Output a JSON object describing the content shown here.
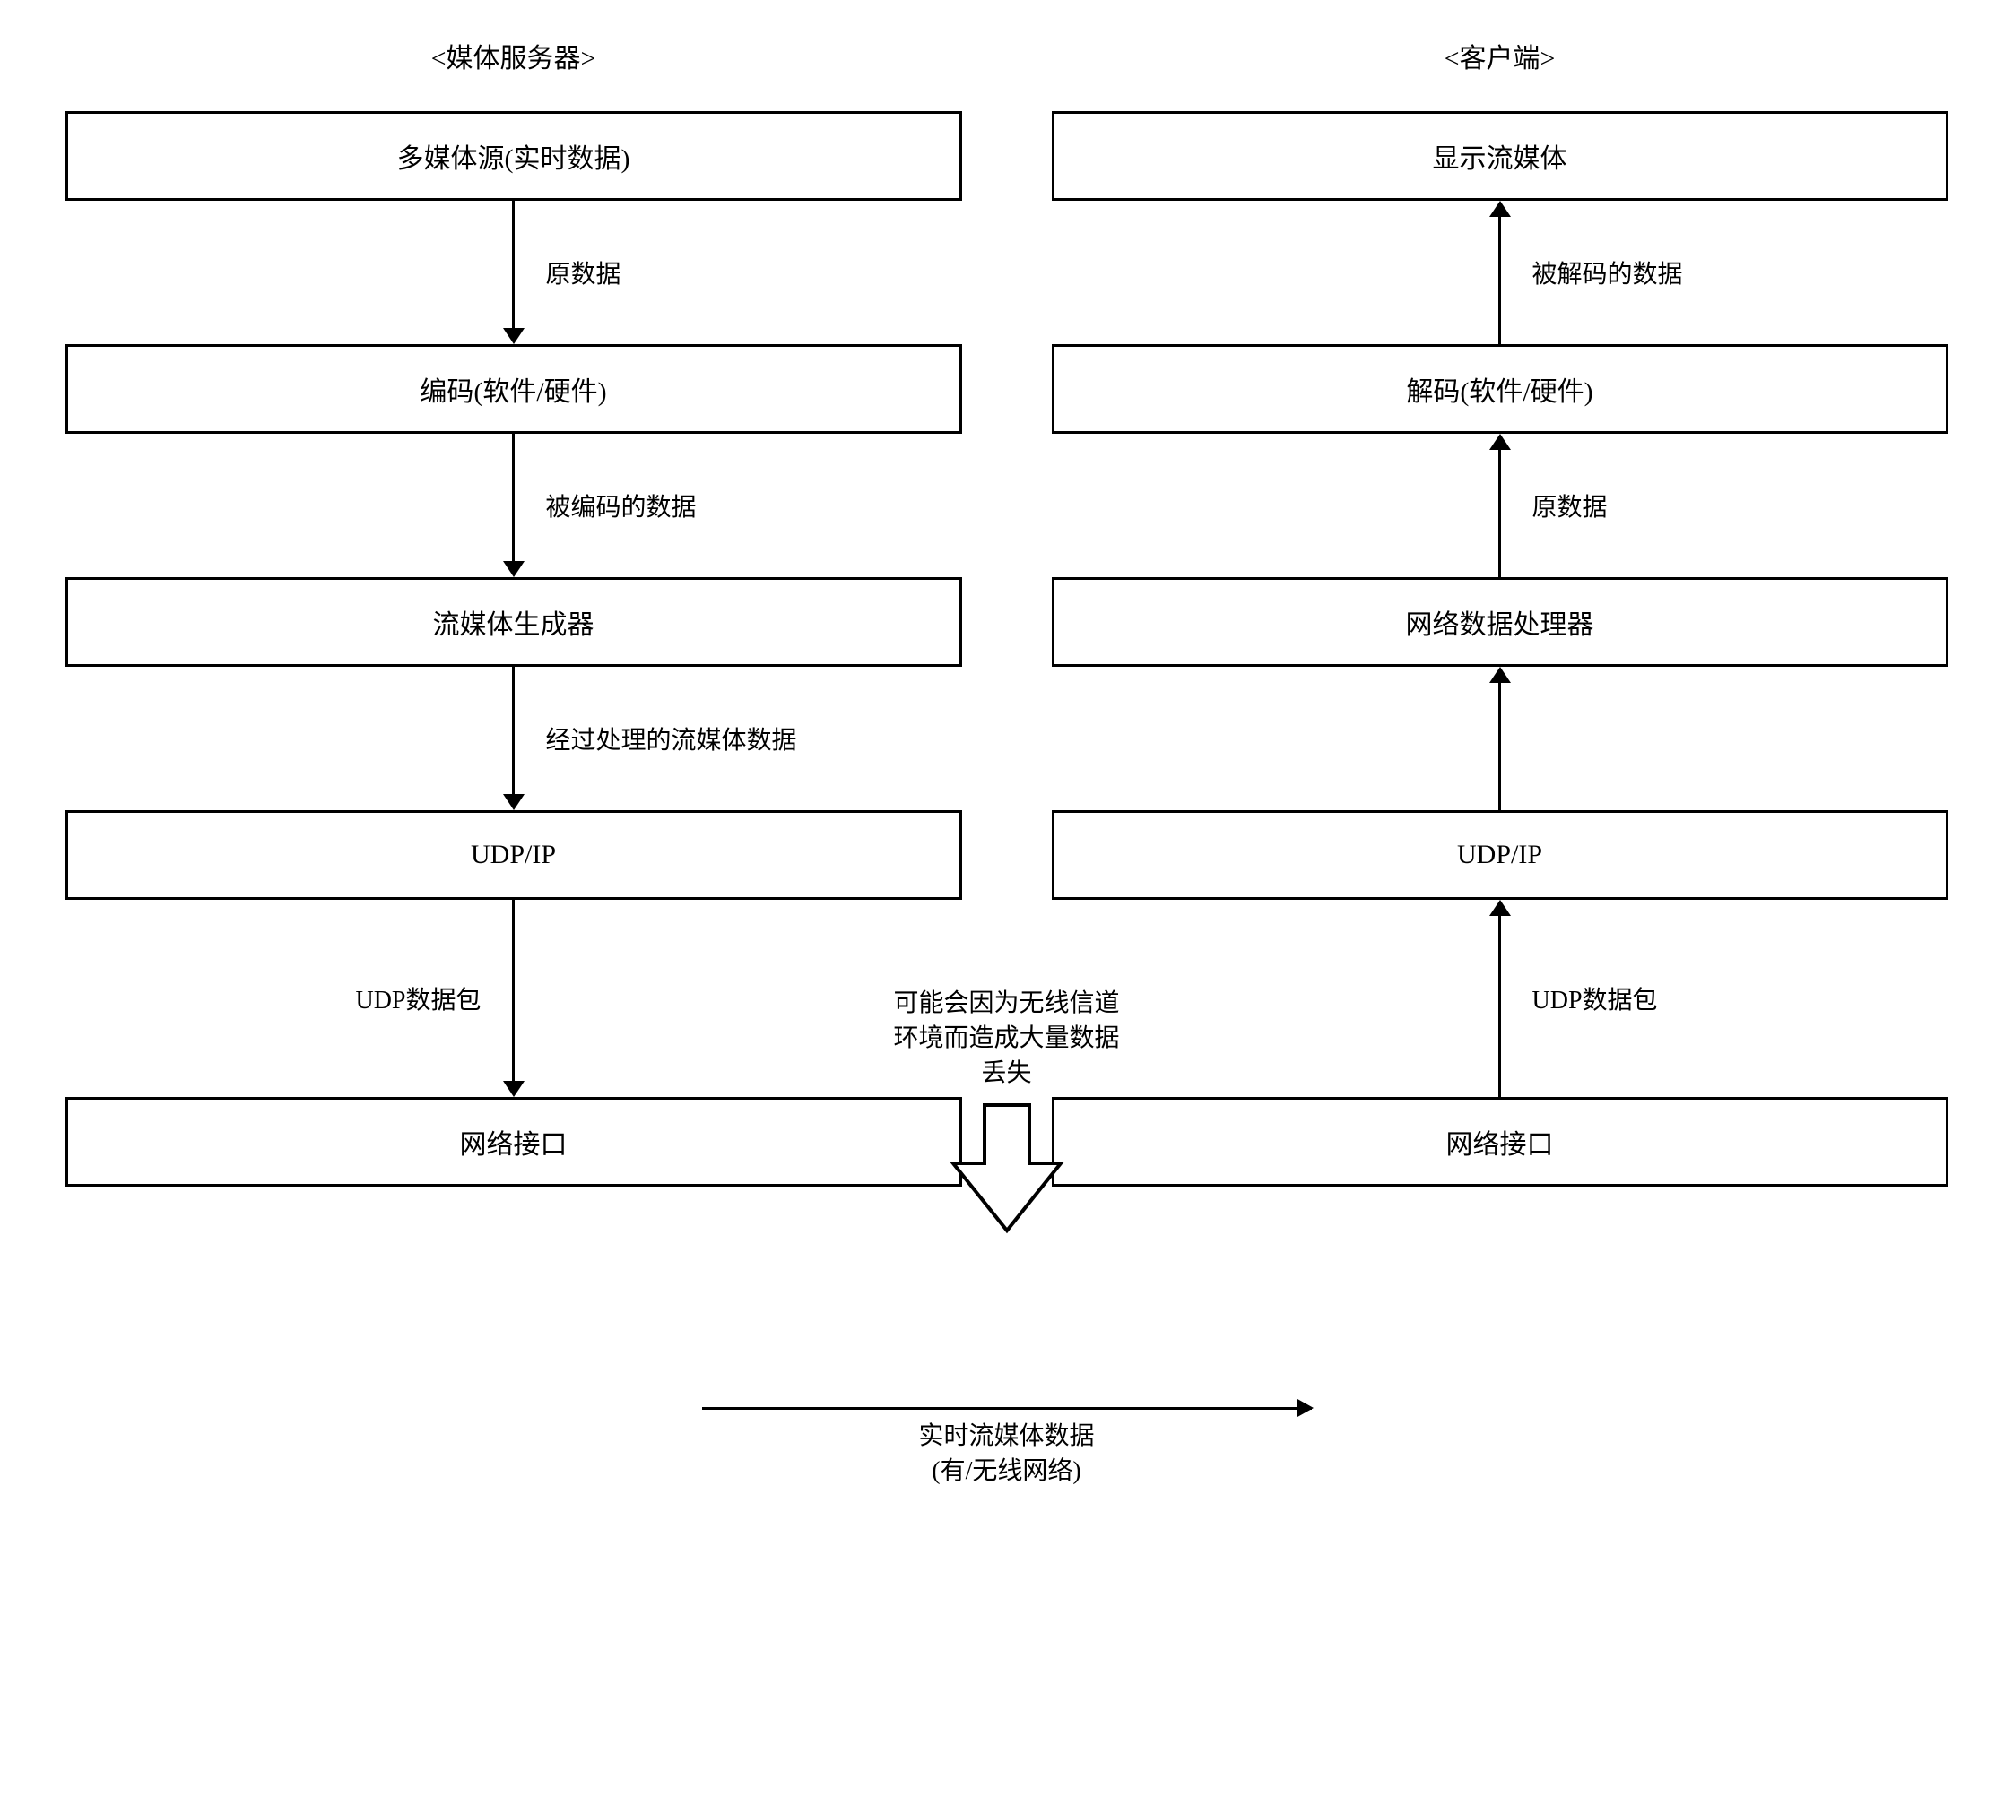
{
  "server": {
    "title": "<媒体服务器>",
    "boxes": {
      "source": "多媒体源(实时数据)",
      "encode": "编码(软件/硬件)",
      "streamer": "流媒体生成器",
      "udpip": "UDP/IP",
      "netif": "网络接口"
    },
    "arrows": {
      "a1": "原数据",
      "a2": "被编码的数据",
      "a3": "经过处理的流媒体数据",
      "a4": "UDP数据包"
    }
  },
  "client": {
    "title": "<客户端>",
    "boxes": {
      "display": "显示流媒体",
      "decode": "解码(软件/硬件)",
      "netproc": "网络数据处理器",
      "udpip": "UDP/IP",
      "netif": "网络接口"
    },
    "arrows": {
      "a1": "被解码的数据",
      "a2": "原数据",
      "a3": "UDP数据包"
    }
  },
  "middle": {
    "warning_line1": "可能会因为无线信道",
    "warning_line2": "环境而造成大量数据",
    "warning_line3": "丢失"
  },
  "bottom": {
    "label_line1": "实时流媒体数据",
    "label_line2": "(有/无线网络)"
  }
}
